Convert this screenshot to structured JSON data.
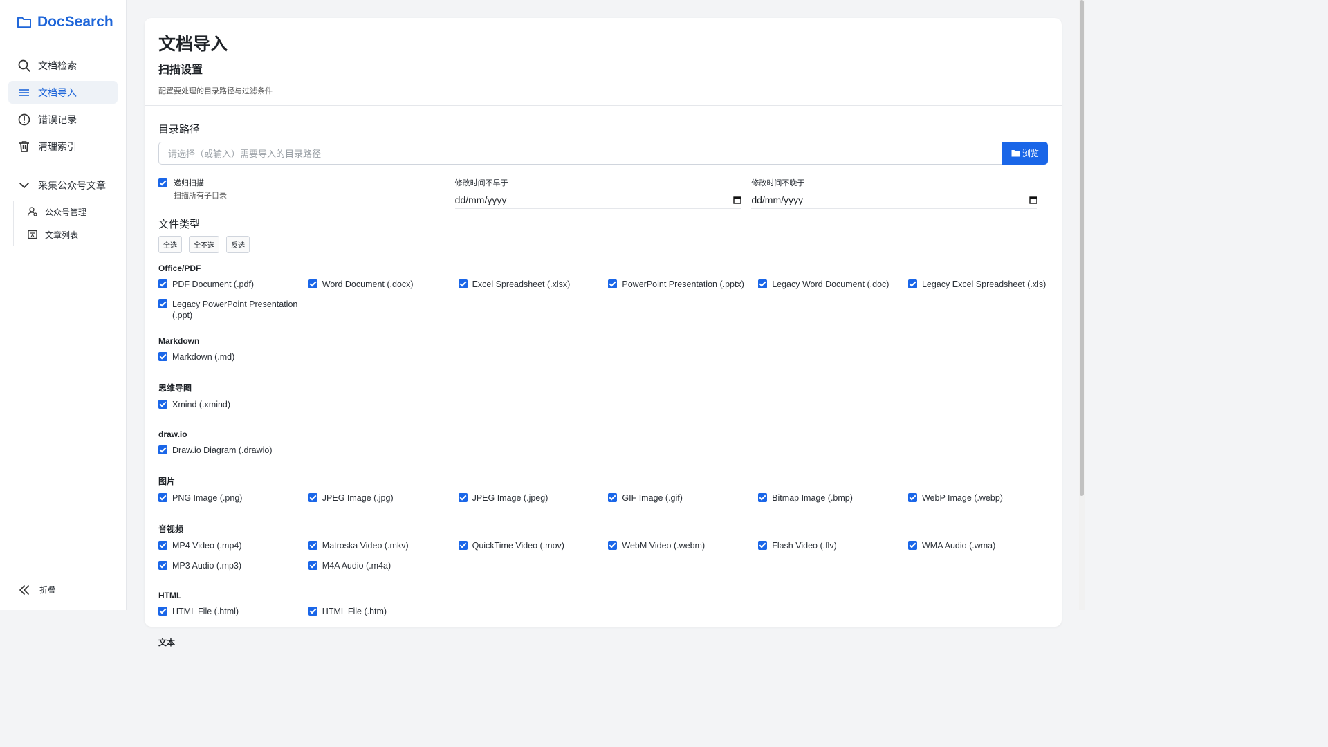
{
  "brand": {
    "name": "DocSearch",
    "icon": "folder-icon",
    "color": "#1f66d9"
  },
  "sidebar": {
    "items": [
      {
        "label": "文档检索",
        "icon": "search-icon"
      },
      {
        "label": "文档导入",
        "icon": "list-icon",
        "active": true
      },
      {
        "label": "错误记录",
        "icon": "alert-circle-icon"
      },
      {
        "label": "清理索引",
        "icon": "trash-icon"
      }
    ],
    "group": {
      "label": "采集公众号文章",
      "icon": "chevron-down-icon",
      "children": [
        {
          "label": "公众号管理",
          "icon": "user-manage-icon"
        },
        {
          "label": "文章列表",
          "icon": "article-list-icon"
        }
      ]
    },
    "collapse_label": "折叠"
  },
  "page": {
    "title": "文档导入",
    "section_title": "扫描设置",
    "description": "配置要处理的目录路径与过滤条件"
  },
  "path": {
    "label": "目录路径",
    "placeholder": "请选择（或输入）需要导入的目录路径",
    "browse_label": "浏览"
  },
  "options": {
    "recursive_label": "递归扫描",
    "recursive_hint": "扫描所有子目录",
    "recursive_checked": true,
    "after_label": "修改时间不早于",
    "after_value": "dd/mm/yyyy",
    "before_label": "修改时间不晚于",
    "before_value": "dd/mm/yyyy"
  },
  "file_types": {
    "label": "文件类型",
    "select_all": "全选",
    "select_none": "全不选",
    "invert": "反选",
    "groups": [
      {
        "title": "Office/PDF",
        "items": [
          "PDF Document (.pdf)",
          "Word Document (.docx)",
          "Excel Spreadsheet (.xlsx)",
          "PowerPoint Presentation (.pptx)",
          "Legacy Word Document (.doc)",
          "Legacy Excel Spreadsheet (.xls)",
          "Legacy PowerPoint Presentation (.ppt)"
        ]
      },
      {
        "title": "Markdown",
        "items": [
          "Markdown (.md)"
        ]
      },
      {
        "title": "思维导图",
        "items": [
          "Xmind (.xmind)"
        ]
      },
      {
        "title": "draw.io",
        "items": [
          "Draw.io Diagram (.drawio)"
        ]
      },
      {
        "title": "图片",
        "items": [
          "PNG Image (.png)",
          "JPEG Image (.jpg)",
          "JPEG Image (.jpeg)",
          "GIF Image (.gif)",
          "Bitmap Image (.bmp)",
          "WebP Image (.webp)"
        ]
      },
      {
        "title": "音视频",
        "items": [
          "MP4 Video (.mp4)",
          "Matroska Video (.mkv)",
          "QuickTime Video (.mov)",
          "WebM Video (.webm)",
          "Flash Video (.flv)",
          "WMA Audio (.wma)",
          "MP3 Audio (.mp3)",
          "M4A Audio (.m4a)"
        ]
      },
      {
        "title": "HTML",
        "items": [
          "HTML File (.html)",
          "HTML File (.htm)"
        ]
      },
      {
        "title": "文本",
        "items": []
      }
    ]
  }
}
